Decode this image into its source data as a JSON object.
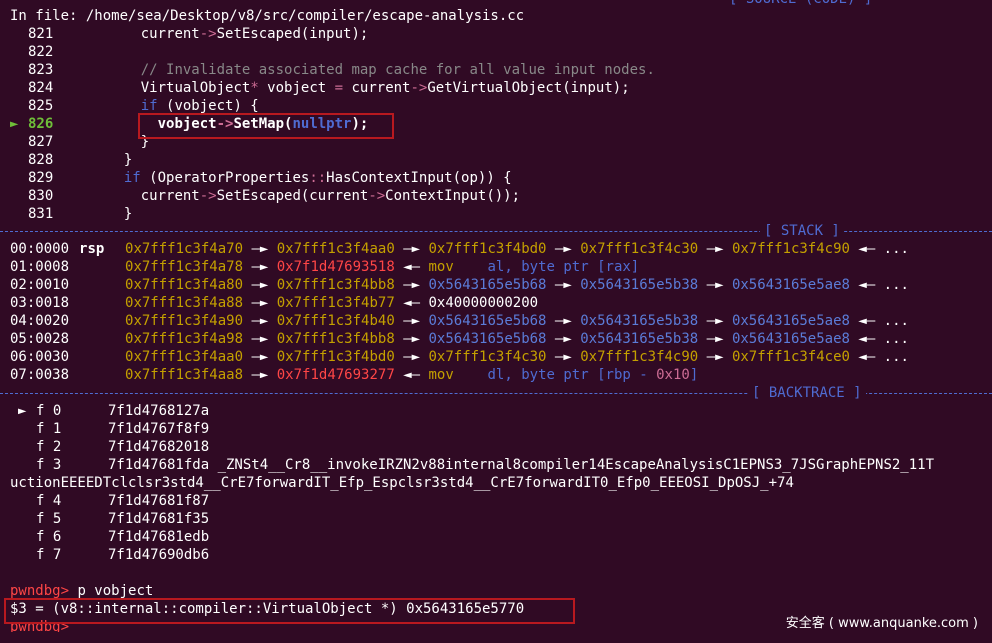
{
  "source": {
    "file_line": "In file: /home/sea/Desktop/v8/src/compiler/escape-analysis.cc",
    "header_title": "[ SOURCE (CODE) ]",
    "lines": [
      {
        "no": "821",
        "segments": [
          [
            "        current",
            "w"
          ],
          [
            "->",
            "p"
          ],
          [
            "SetEscaped(input);",
            "w"
          ]
        ]
      },
      {
        "no": "822",
        "segments": []
      },
      {
        "no": "823",
        "segments": [
          [
            "        // Invalidate associated map cache for all value input nodes.",
            "c"
          ]
        ]
      },
      {
        "no": "824",
        "segments": [
          [
            "        VirtualObject",
            "w"
          ],
          [
            "*",
            "p"
          ],
          [
            " vobject ",
            "w"
          ],
          [
            "=",
            "p"
          ],
          [
            " current",
            "w"
          ],
          [
            "->",
            "p"
          ],
          [
            "GetVirtualObject(input);",
            "w"
          ]
        ]
      },
      {
        "no": "825",
        "segments": [
          [
            "        ",
            "w"
          ],
          [
            "if",
            "b"
          ],
          [
            " (vobject) {",
            "w"
          ]
        ]
      },
      {
        "no": "826",
        "current": true,
        "segments": [
          [
            "          vobject",
            "wb"
          ],
          [
            "->",
            "pb"
          ],
          [
            "SetMap(",
            "wb"
          ],
          [
            "nullptr",
            "bb"
          ],
          [
            ");",
            "wb"
          ]
        ]
      },
      {
        "no": "827",
        "segments": [
          [
            "        }",
            "w"
          ]
        ]
      },
      {
        "no": "828",
        "segments": [
          [
            "      }",
            "w"
          ]
        ]
      },
      {
        "no": "829",
        "segments": [
          [
            "      ",
            "w"
          ],
          [
            "if",
            "b"
          ],
          [
            " (OperatorProperties",
            "w"
          ],
          [
            "::",
            "p"
          ],
          [
            "HasContextInput(op)) {",
            "w"
          ]
        ]
      },
      {
        "no": "830",
        "segments": [
          [
            "        current",
            "w"
          ],
          [
            "->",
            "p"
          ],
          [
            "SetEscaped(current",
            "w"
          ],
          [
            "->",
            "p"
          ],
          [
            "ContextInput());",
            "w"
          ]
        ]
      },
      {
        "no": "831",
        "segments": [
          [
            "      }",
            "w"
          ]
        ]
      }
    ],
    "current_marker": "►"
  },
  "stack": {
    "header_title": "[ STACK ]",
    "rows": [
      {
        "off": "00:0000",
        "reg": "rsp",
        "segments": [
          [
            "0x7fff1c3f4a70",
            "y"
          ],
          [
            " —► ",
            "w"
          ],
          [
            "0x7fff1c3f4aa0",
            "y"
          ],
          [
            " —► ",
            "w"
          ],
          [
            "0x7fff1c3f4bd0",
            "y"
          ],
          [
            " —► ",
            "w"
          ],
          [
            "0x7fff1c3f4c30",
            "y"
          ],
          [
            " —► ",
            "w"
          ],
          [
            "0x7fff1c3f4c90",
            "y"
          ],
          [
            " ◄— ...",
            "w"
          ]
        ]
      },
      {
        "off": "01:0008",
        "reg": "",
        "segments": [
          [
            "0x7fff1c3f4a78",
            "y"
          ],
          [
            " —► ",
            "w"
          ],
          [
            "0x7f1d47693518",
            "r"
          ],
          [
            " ◄— ",
            "w"
          ],
          [
            "mov",
            "m"
          ],
          [
            "    al, ",
            "b"
          ],
          [
            "byte ptr",
            "b"
          ],
          [
            " [rax]",
            "b"
          ]
        ]
      },
      {
        "off": "02:0010",
        "reg": "",
        "segments": [
          [
            "0x7fff1c3f4a80",
            "y"
          ],
          [
            " —► ",
            "w"
          ],
          [
            "0x7fff1c3f4bb8",
            "y"
          ],
          [
            " —► ",
            "w"
          ],
          [
            "0x5643165e5b68",
            "h"
          ],
          [
            " —► ",
            "w"
          ],
          [
            "0x5643165e5b38",
            "h"
          ],
          [
            " —► ",
            "w"
          ],
          [
            "0x5643165e5ae8",
            "h"
          ],
          [
            " ◄— ...",
            "w"
          ]
        ]
      },
      {
        "off": "03:0018",
        "reg": "",
        "segments": [
          [
            "0x7fff1c3f4a88",
            "y"
          ],
          [
            " —► ",
            "w"
          ],
          [
            "0x7fff1c3f4b77",
            "y"
          ],
          [
            " ◄— 0x40000000200",
            "w"
          ]
        ]
      },
      {
        "off": "04:0020",
        "reg": "",
        "segments": [
          [
            "0x7fff1c3f4a90",
            "y"
          ],
          [
            " —► ",
            "w"
          ],
          [
            "0x7fff1c3f4b40",
            "y"
          ],
          [
            " —► ",
            "w"
          ],
          [
            "0x5643165e5b68",
            "h"
          ],
          [
            " —► ",
            "w"
          ],
          [
            "0x5643165e5b38",
            "h"
          ],
          [
            " —► ",
            "w"
          ],
          [
            "0x5643165e5ae8",
            "h"
          ],
          [
            " ◄— ...",
            "w"
          ]
        ]
      },
      {
        "off": "05:0028",
        "reg": "",
        "segments": [
          [
            "0x7fff1c3f4a98",
            "y"
          ],
          [
            " —► ",
            "w"
          ],
          [
            "0x7fff1c3f4bb8",
            "y"
          ],
          [
            " —► ",
            "w"
          ],
          [
            "0x5643165e5b68",
            "h"
          ],
          [
            " —► ",
            "w"
          ],
          [
            "0x5643165e5b38",
            "h"
          ],
          [
            " —► ",
            "w"
          ],
          [
            "0x5643165e5ae8",
            "h"
          ],
          [
            " ◄— ...",
            "w"
          ]
        ]
      },
      {
        "off": "06:0030",
        "reg": "",
        "segments": [
          [
            "0x7fff1c3f4aa0",
            "y"
          ],
          [
            " —► ",
            "w"
          ],
          [
            "0x7fff1c3f4bd0",
            "y"
          ],
          [
            " —► ",
            "w"
          ],
          [
            "0x7fff1c3f4c30",
            "y"
          ],
          [
            " —► ",
            "w"
          ],
          [
            "0x7fff1c3f4c90",
            "y"
          ],
          [
            " —► ",
            "w"
          ],
          [
            "0x7fff1c3f4ce0",
            "y"
          ],
          [
            " ◄— ...",
            "w"
          ]
        ]
      },
      {
        "off": "07:0038",
        "reg": "",
        "segments": [
          [
            "0x7fff1c3f4aa8",
            "y"
          ],
          [
            " —► ",
            "w"
          ],
          [
            "0x7f1d47693277",
            "r"
          ],
          [
            " ◄— ",
            "w"
          ],
          [
            "mov",
            "m"
          ],
          [
            "    dl, ",
            "b"
          ],
          [
            "byte ptr",
            "b"
          ],
          [
            " [rbp - ",
            "b"
          ],
          [
            "0x10",
            "p"
          ],
          [
            "]",
            "b"
          ]
        ]
      }
    ]
  },
  "backtrace": {
    "header_title": "[ BACKTRACE ]",
    "frames": [
      {
        "marker": "►",
        "label": "f 0",
        "addr": "7f1d4768127a"
      },
      {
        "marker": "",
        "label": "f 1",
        "addr": "7f1d4767f8f9"
      },
      {
        "marker": "",
        "label": "f 2",
        "addr": "7f1d47682018"
      },
      {
        "marker": "",
        "label": "f 3",
        "addr": "7f1d47681fda _ZNSt4__Cr8__invokeIRZN2v88internal8compiler14EscapeAnalysisC1EPNS3_7JSGraphEPNS2_11T"
      },
      {
        "marker": "",
        "label": "",
        "addr": "uctionEEEEDTclclsr3std4__CrE7forwardIT_Efp_Espclsr3std4__CrE7forwardIT0_Efp0_EEEOSI_DpOSJ_+74",
        "wrap": true
      },
      {
        "marker": "",
        "label": "f 4",
        "addr": "7f1d47681f87"
      },
      {
        "marker": "",
        "label": "f 5",
        "addr": "7f1d47681f35"
      },
      {
        "marker": "",
        "label": "f 6",
        "addr": "7f1d47681edb"
      },
      {
        "marker": "",
        "label": "f 7",
        "addr": "7f1d47690db6"
      }
    ]
  },
  "console": {
    "prompt": "pwndbg>",
    "command": " p vobject",
    "result": "$3 = (v8::internal::compiler::VirtualObject *) 0x5643165e5770",
    "prompt2": "pwndbg>"
  },
  "watermark": "安全客 ( www.anquanke.com )"
}
